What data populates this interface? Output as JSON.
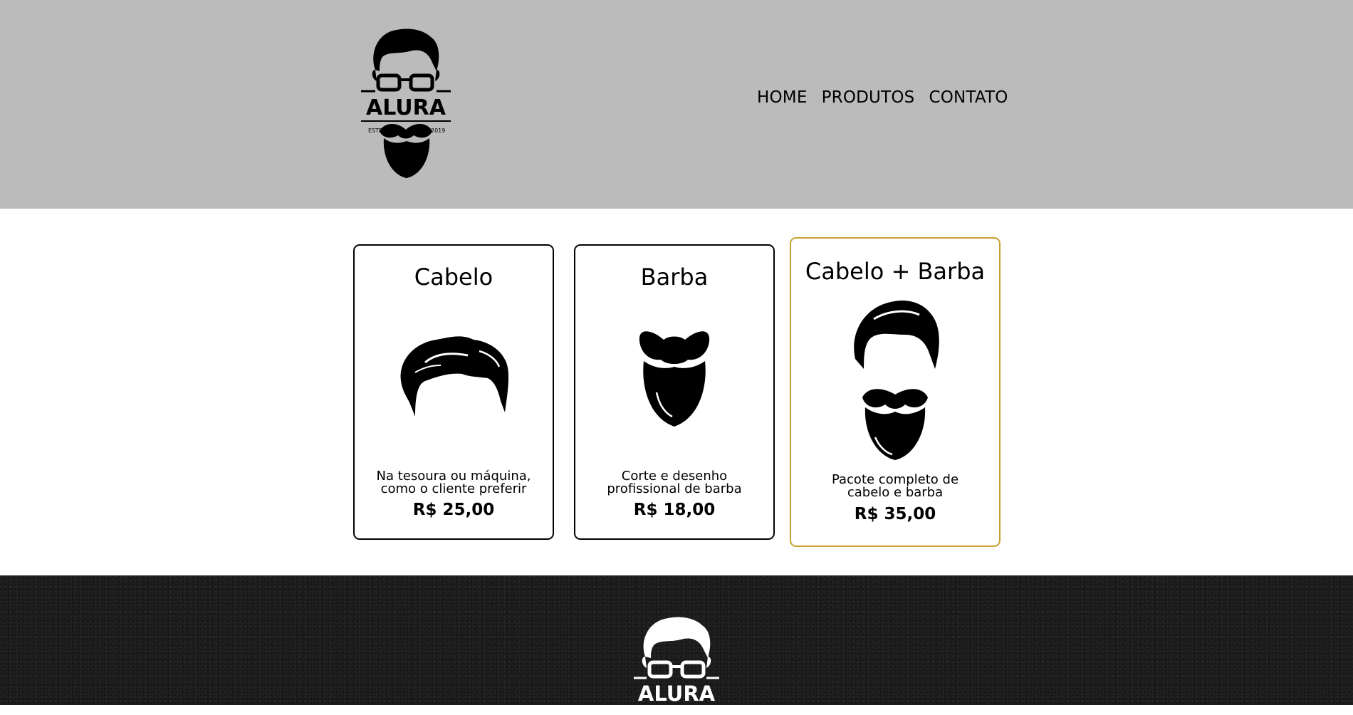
{
  "header": {
    "logo": {
      "text": "ALURA",
      "left_tag": "ESTD",
      "right_tag": "2019"
    },
    "nav": [
      {
        "label": "HOME"
      },
      {
        "label": "PRODUTOS"
      },
      {
        "label": "CONTATO"
      }
    ]
  },
  "cards": [
    {
      "title": "Cabelo",
      "icon": "hair-icon",
      "description": "Na tesoura ou máquina,\ncomo o cliente preferir",
      "price": "R$ 25,00"
    },
    {
      "title": "Barba",
      "icon": "beard-icon",
      "description": "Corte e desenho\nprofissional de barba",
      "price": "R$ 18,00"
    },
    {
      "title": "Cabelo + Barba",
      "icon": "hair-and-beard-icon",
      "description": "Pacote completo de\ncabelo e barba",
      "price": "R$ 35,00"
    }
  ],
  "footer": {
    "logo": {
      "text": "ALURA"
    }
  },
  "colors": {
    "header_bg": "#bbbbbb",
    "footer_bg": "#1d1d1d",
    "featured_border": "#c9a033"
  }
}
